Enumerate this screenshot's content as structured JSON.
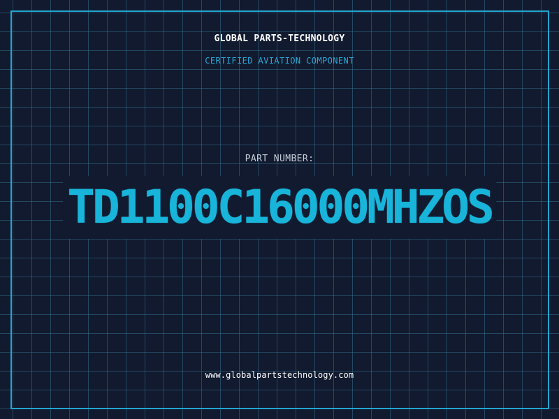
{
  "header": {
    "company": "GLOBAL PARTS-TECHNOLOGY",
    "subtitle": "CERTIFIED AVIATION COMPONENT"
  },
  "part": {
    "label": "PART NUMBER:",
    "number": "TD1100C16000MHZOS"
  },
  "footer": {
    "website": "www.globalpartstechnology.com"
  },
  "colors": {
    "background": "#111a2e",
    "grid": "#346e8c",
    "frame": "#23a5cf",
    "accent": "#18b4da",
    "text": "#ffffff"
  }
}
